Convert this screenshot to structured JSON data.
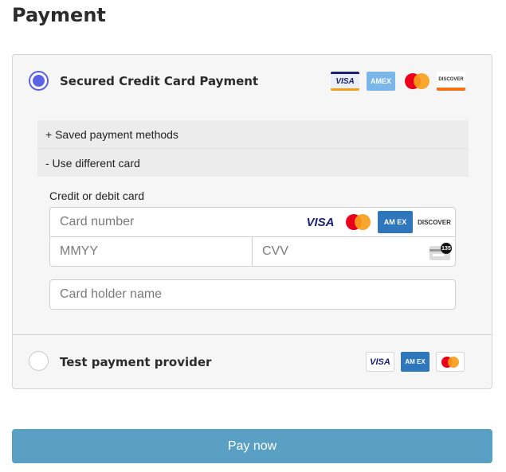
{
  "page": {
    "title": "Payment"
  },
  "options": {
    "credit_card": {
      "label": "Secured Credit Card Payment",
      "selected": true,
      "brands": [
        "visa-icon",
        "amex-icon",
        "mastercard-icon",
        "discover-icon"
      ]
    },
    "test_provider": {
      "label": "Test payment provider",
      "selected": false,
      "brands": [
        "visa-icon",
        "amex-icon",
        "mastercard-icon"
      ]
    }
  },
  "accordion": {
    "saved_methods": "+ Saved payment methods",
    "different_card": "- Use different card"
  },
  "card_form": {
    "caption": "Credit or debit card",
    "card_number_placeholder": "Card number",
    "expiry_placeholder": "MMYY",
    "cvv_placeholder": "CVV",
    "holder_placeholder": "Card holder name",
    "cvv_hint": "135"
  },
  "brand_text": {
    "visa": "VISA",
    "amex": "AMEX",
    "amex_short": "AM EX",
    "discover": "DISCOVER"
  },
  "colors": {
    "accent": "#5a63e6",
    "pay_button": "#5aa0c4",
    "visa_blue": "#1a1f71",
    "amex_blue": "#2e77bc",
    "mc_red": "#eb001b",
    "mc_orange": "#f79e1b",
    "discover_orange": "#f47216"
  },
  "actions": {
    "pay_label": "Pay now"
  }
}
